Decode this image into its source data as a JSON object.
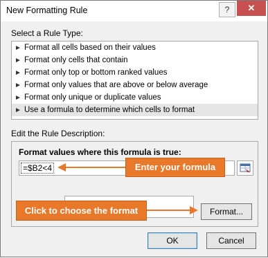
{
  "window": {
    "title": "New Formatting Rule",
    "help_label": "?",
    "close_label": "✕"
  },
  "rule_type": {
    "label": "Select a Rule Type:",
    "items": [
      {
        "label": "Format all cells based on their values"
      },
      {
        "label": "Format only cells that contain"
      },
      {
        "label": "Format only top or bottom ranked values"
      },
      {
        "label": "Format only values that are above or below average"
      },
      {
        "label": "Format only unique or duplicate values"
      },
      {
        "label": "Use a formula to determine which cells to format"
      }
    ],
    "selected_index": 5,
    "item_marker": "►"
  },
  "description": {
    "label": "Edit the Rule Description:",
    "heading": "Format values where this formula is true:",
    "formula_value": "=$B2<4",
    "format_button": "Format..."
  },
  "callouts": {
    "formula": "Enter your formula",
    "format": "Click to choose the format",
    "color": "#e8782a"
  },
  "buttons": {
    "ok": "OK",
    "cancel": "Cancel"
  },
  "icons": [
    "help-icon",
    "close-icon",
    "range-select-icon"
  ]
}
